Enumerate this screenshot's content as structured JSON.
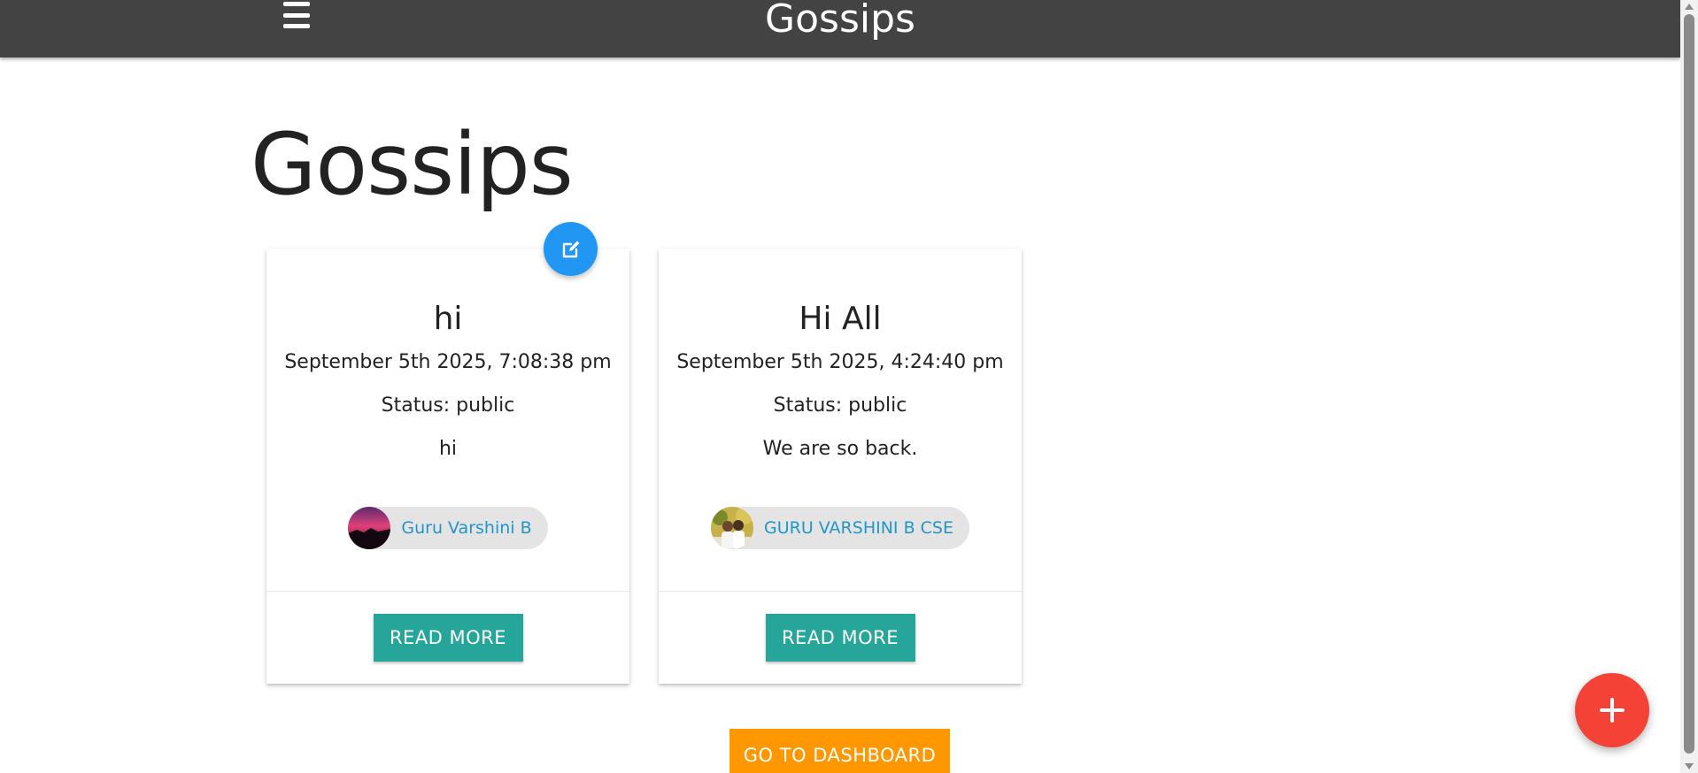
{
  "navbar": {
    "brand": "Gossips",
    "menu_icon": "hamburger-menu-icon"
  },
  "page": {
    "title": "Gossips"
  },
  "cards": [
    {
      "title": "hi",
      "date": "September 5th 2025, 7:08:38 pm",
      "status": "Status: public",
      "body": "hi",
      "author": "Guru Varshini B",
      "read_more": "READ MORE",
      "editable": true
    },
    {
      "title": "Hi All",
      "date": "September 5th 2025, 4:24:40 pm",
      "status": "Status: public",
      "body": "We are so back.",
      "author": "GURU VARSHINI B CSE",
      "read_more": "READ MORE",
      "editable": false
    }
  ],
  "actions": {
    "dashboard": "GO TO DASHBOARD"
  },
  "colors": {
    "navbar": "#434343",
    "read_more": "#26a69a",
    "dashboard": "#ff9800",
    "fab_add": "#f44336",
    "fab_edit": "#2196f3",
    "chip_link": "#2196c8"
  },
  "icons": {
    "edit": "edit-icon",
    "add": "add-icon"
  }
}
